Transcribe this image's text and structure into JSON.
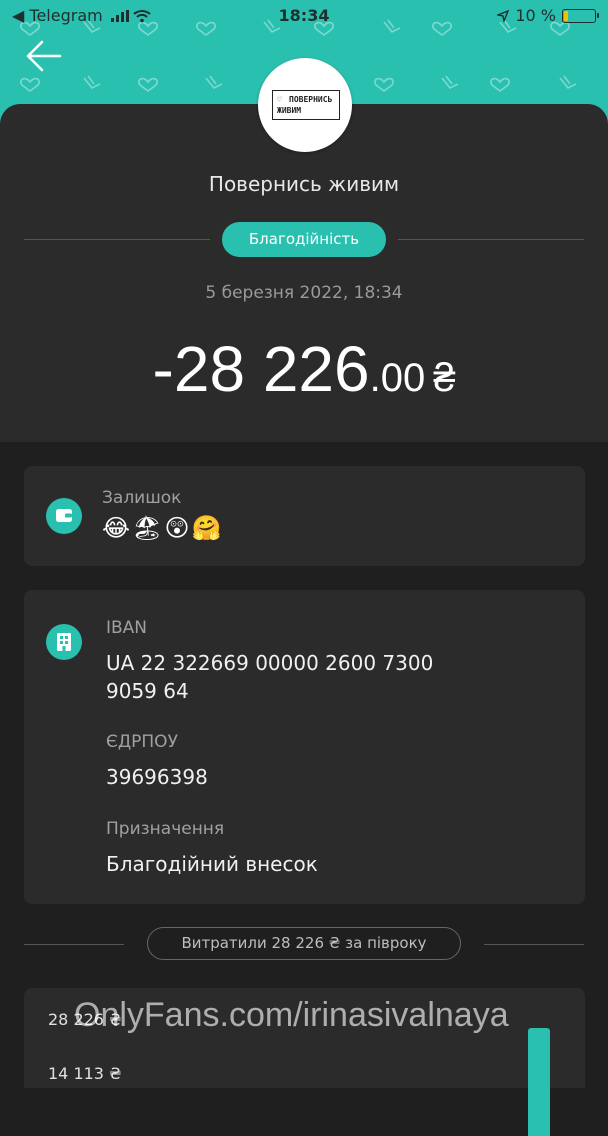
{
  "status_bar": {
    "back_app": "◀ Telegram",
    "time": "18:34",
    "battery": "10 %",
    "battery_level": 0.1
  },
  "merchant": {
    "logo_line1": "ПОВЕРНИСЬ",
    "logo_line2": "ЖИВИМ",
    "name": "Повернись живим",
    "category": "Благодійність",
    "date": "5 березня 2022, 18:34"
  },
  "amount": {
    "main": "-28 226",
    "decimals": ".00",
    "currency": "₴"
  },
  "balance": {
    "label": "Залишок",
    "emojis": "😂🏖😲🤗"
  },
  "details": {
    "iban_label": "IBAN",
    "iban_line1": "UA 22 322669 00000 2600 7300",
    "iban_line2": "9059 64",
    "edrpou_label": "ЄДРПОУ",
    "edrpou_value": "39696398",
    "purpose_label": "Призначення",
    "purpose_value": "Благодійний внесок"
  },
  "spending": {
    "label": "Витратили 28 226 ₴ за півроку"
  },
  "chart_data": {
    "type": "bar",
    "tick_labels": [
      "28 226 ₴",
      "14 113 ₴"
    ],
    "ylim": [
      0,
      28226
    ],
    "values": [
      28226
    ]
  },
  "watermark": "OnlyFans.com/irinasivalnaya",
  "colors": {
    "accent": "#2ac0b0",
    "background": "#1f1f1f",
    "card": "#2b2b2b"
  }
}
